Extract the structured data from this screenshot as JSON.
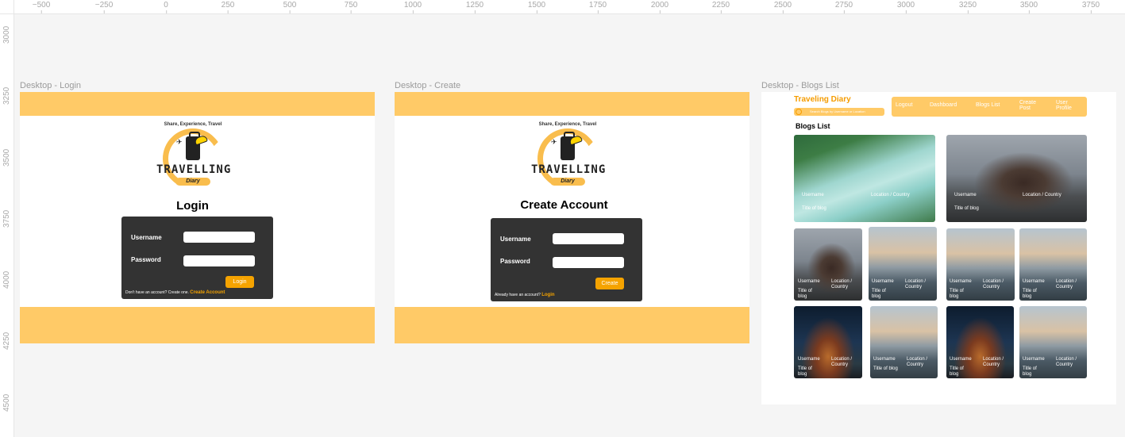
{
  "ruler": {
    "top_ticks": [
      "−500",
      "−250",
      "0",
      "250",
      "500",
      "750",
      "1000",
      "1250",
      "1500",
      "1750",
      "2000",
      "2250",
      "2500",
      "2750",
      "3000",
      "3250",
      "3500",
      "3750"
    ],
    "left_ticks": [
      "3000",
      "3250",
      "3500",
      "3750",
      "4000",
      "4250",
      "4500"
    ]
  },
  "frames": {
    "login": {
      "label": "Desktop - Login"
    },
    "create": {
      "label": "Desktop - Create"
    },
    "blogs": {
      "label": "Desktop - Blogs List"
    }
  },
  "logo": {
    "tagline": "Share, Experience, Travel",
    "word": "TRAVELLING",
    "ribbon": "Diary"
  },
  "login": {
    "heading": "Login",
    "username_label": "Username",
    "password_label": "Password",
    "button": "Login",
    "foot_text": "Don't have an account? Create one.",
    "foot_link": "Create Account"
  },
  "create": {
    "heading": "Create Account",
    "username_label": "Username",
    "password_label": "Password",
    "button": "Create",
    "foot_text": "Already have an account?",
    "foot_link": "Login"
  },
  "blogs": {
    "brand": "Traveling Diary",
    "search_placeholder": "Search Blogs by Username or Location",
    "nav": [
      "Logout",
      "Dashboard",
      "Blogs List",
      "Create Post",
      "User Profile"
    ],
    "title": "Blogs List",
    "tile_username": "Username",
    "tile_location": "Location / Country",
    "tile_title": "Title of blog"
  },
  "colors": {
    "accent": "#ffca67",
    "button": "#f5a300",
    "card": "#333333"
  }
}
